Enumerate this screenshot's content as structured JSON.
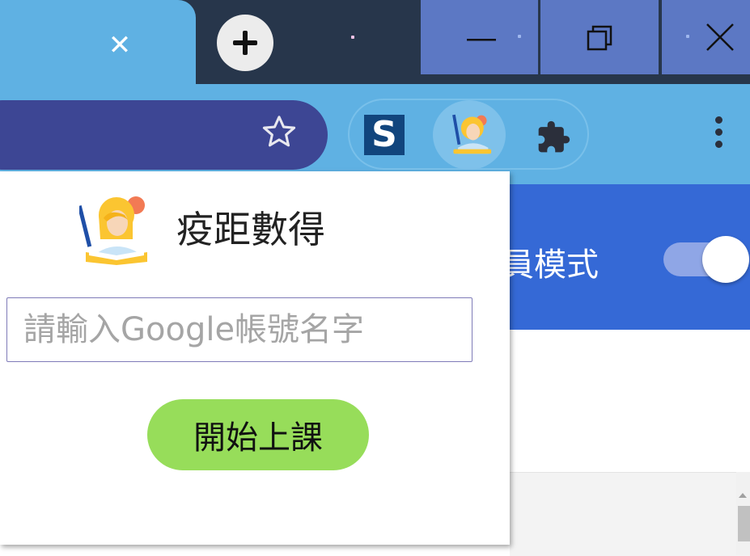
{
  "tabstrip": {
    "tab_close_icon": "close-icon",
    "new_tab_icon": "plus-icon",
    "window_controls": [
      "minimize-icon",
      "restore-icon",
      "close-icon"
    ]
  },
  "toolbar": {
    "bookmark_icon": "star-outline-icon",
    "extensions": [
      "s-extension-icon",
      "teacher-extension-icon",
      "puzzle-icon"
    ],
    "menu_icon": "kebab-menu-icon"
  },
  "page": {
    "mode_label": "員模式",
    "toggle_on": true,
    "colors": {
      "header": "#3569d6",
      "toggle_track": "#8fa6e6"
    }
  },
  "popup": {
    "logo_icon": "teacher-reading-icon",
    "title": "疫距數得",
    "input": {
      "placeholder": "請輸入Google帳號名字",
      "value": ""
    },
    "start_button": "開始上課",
    "colors": {
      "button": "#97dd5a",
      "input_border": "#7f7bb8"
    }
  },
  "colors": {
    "tabstrip": "#27364b",
    "toolbar": "#5fb1e3",
    "omnibox": "#3d4694",
    "window_buttons": "#5c78c4"
  }
}
